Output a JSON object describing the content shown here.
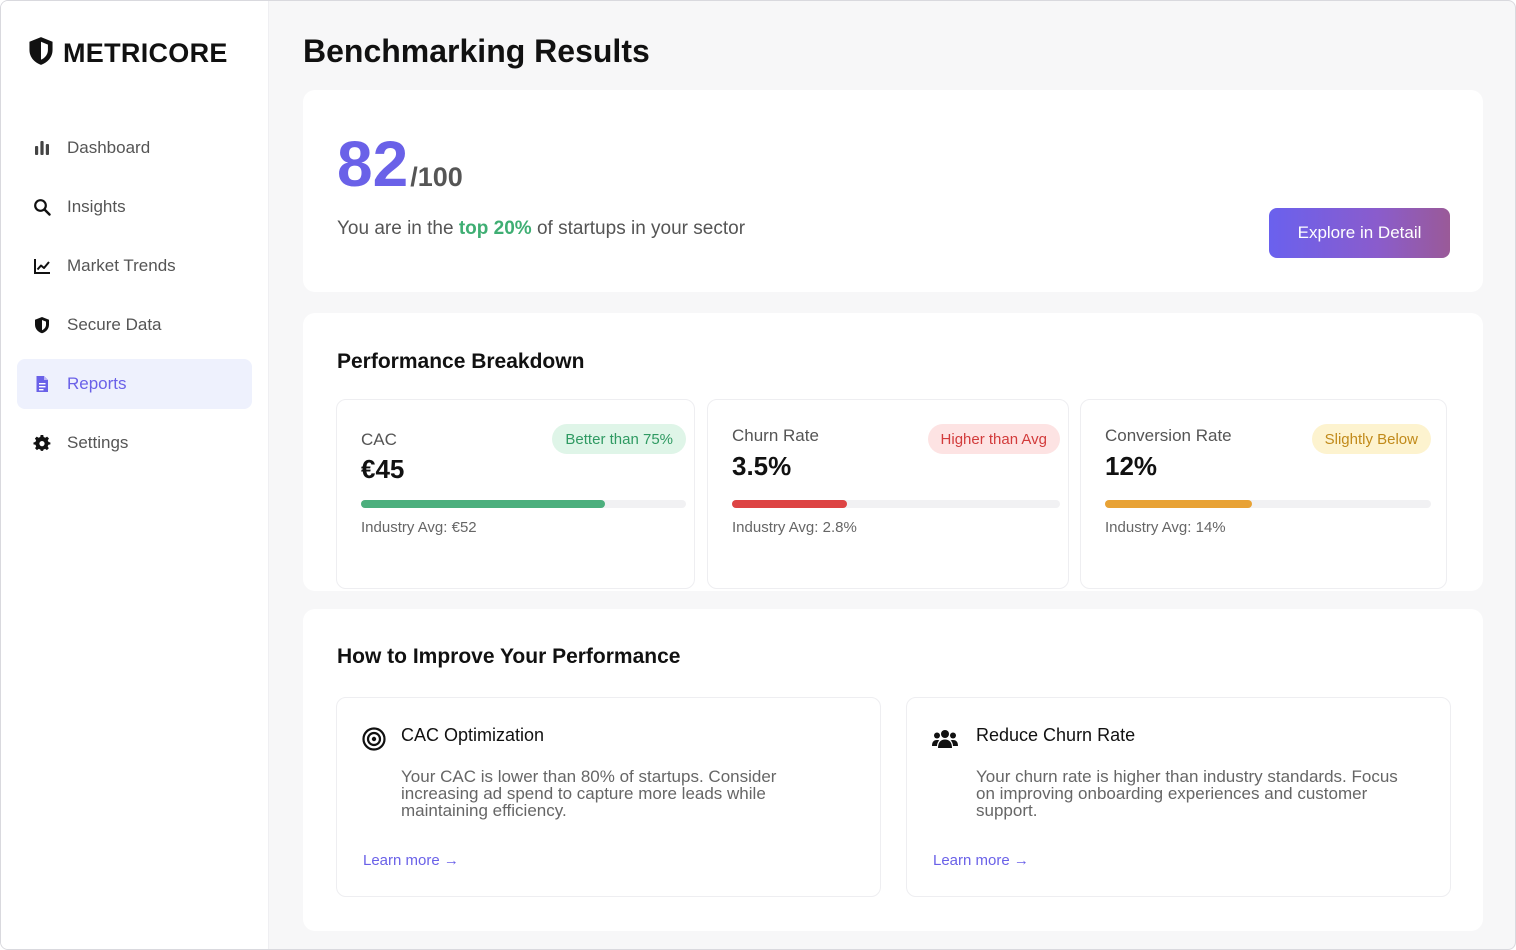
{
  "brand": {
    "name": "METRICORE"
  },
  "sidebar": {
    "items": [
      {
        "label": "Dashboard",
        "icon": "bar-chart-icon",
        "active": false
      },
      {
        "label": "Insights",
        "icon": "search-icon",
        "active": false
      },
      {
        "label": "Market Trends",
        "icon": "line-chart-icon",
        "active": false
      },
      {
        "label": "Secure Data",
        "icon": "shield-icon",
        "active": false
      },
      {
        "label": "Reports",
        "icon": "document-icon",
        "active": true
      },
      {
        "label": "Settings",
        "icon": "gear-icon",
        "active": false
      }
    ]
  },
  "page": {
    "title": "Benchmarking Results"
  },
  "score": {
    "value": "82",
    "max": "/100",
    "text_before": "You are in the ",
    "highlight": "top 20%",
    "text_after": " of startups in your sector",
    "button_label": "Explore in Detail"
  },
  "performance": {
    "title": "Performance Breakdown",
    "metrics": [
      {
        "label": "CAC",
        "value": "€45",
        "badge": "Better than 75%",
        "progress": 0.75,
        "avg": "Industry Avg: €52",
        "color": "#4caf7d",
        "badge_bg": "#dff5e8",
        "badge_fg": "#2f9a62"
      },
      {
        "label": "Churn Rate",
        "value": "3.5%",
        "badge": "Higher than Avg",
        "progress": 0.35,
        "avg": "Industry Avg: 2.8%",
        "color": "#dd4444",
        "badge_bg": "#fde3e3",
        "badge_fg": "#d23b3b"
      },
      {
        "label": "Conversion Rate",
        "value": "12%",
        "badge": "Slightly Below",
        "progress": 0.45,
        "avg": "Industry Avg: 14%",
        "color": "#e8a235",
        "badge_bg": "#fdf3cf",
        "badge_fg": "#c18a1a"
      }
    ]
  },
  "improve": {
    "title": "How to Improve Your Performance",
    "tips": [
      {
        "icon": "target-icon",
        "title": "CAC Optimization",
        "body": "Your CAC is lower than 80% of startups. Consider increasing ad spend to capture more leads while maintaining efficiency.",
        "link": "Learn more →"
      },
      {
        "icon": "users-icon",
        "title": "Reduce Churn Rate",
        "body": "Your churn rate is higher than industry standards. Focus on improving onboarding experiences and customer support.",
        "link": "Learn more →"
      }
    ]
  },
  "colors": {
    "accent": "#6a61e8",
    "positive": "#3fae73"
  }
}
